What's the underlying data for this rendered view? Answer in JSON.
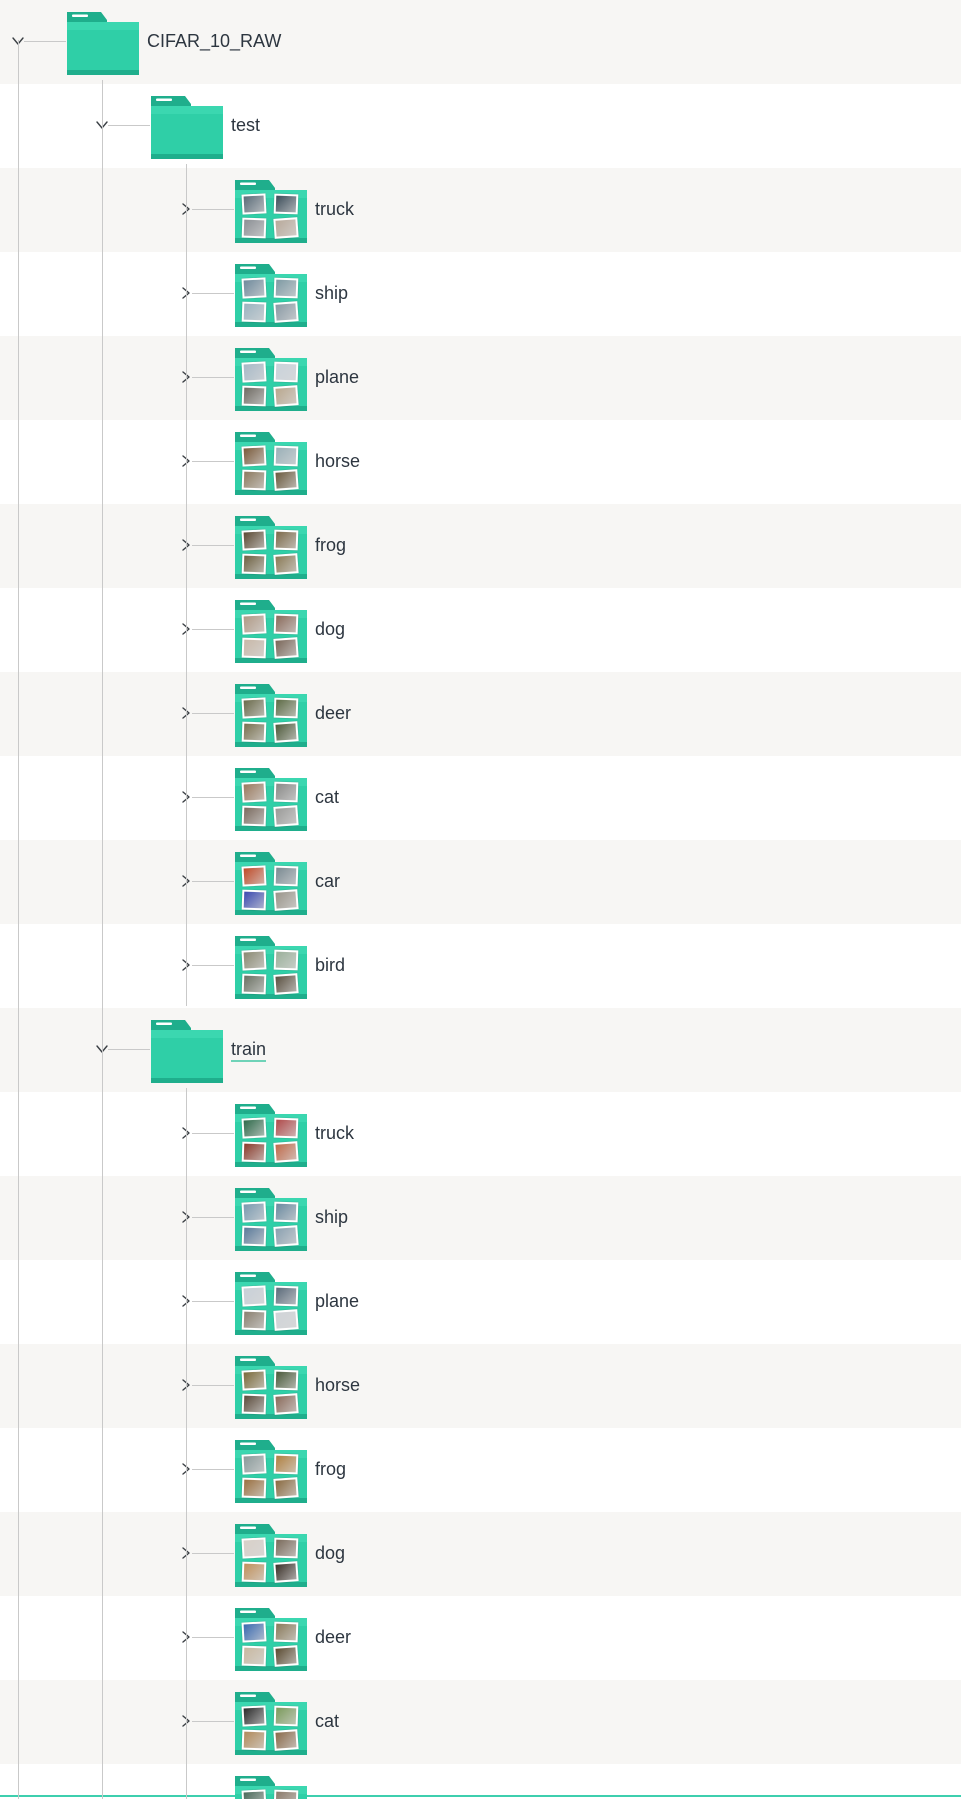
{
  "tree": {
    "root": {
      "label": "CIFAR_10_RAW",
      "expanded": true,
      "children": [
        {
          "label": "test",
          "expanded": true,
          "children": [
            {
              "label": "truck",
              "thumbs": [
                "#5a6b78",
                "#3b4c59",
                "#8b8f94",
                "#b8a99a"
              ]
            },
            {
              "label": "ship",
              "thumbs": [
                "#6f8a9c",
                "#7e9aa4",
                "#9bb3c0",
                "#8a9aa5"
              ]
            },
            {
              "label": "plane",
              "thumbs": [
                "#a7b9c7",
                "#c9d3db",
                "#6e6a62",
                "#b9a78e"
              ]
            },
            {
              "label": "horse",
              "thumbs": [
                "#7a5a3a",
                "#9ab0b8",
                "#8c7a5e",
                "#6b5a3e"
              ]
            },
            {
              "label": "frog",
              "thumbs": [
                "#5b4a33",
                "#7d6a4a",
                "#6d6040",
                "#8a7a55"
              ]
            },
            {
              "label": "dog",
              "thumbs": [
                "#b09a86",
                "#8a6a5a",
                "#c8b8a8",
                "#7a6658"
              ]
            },
            {
              "label": "deer",
              "thumbs": [
                "#6a6a4a",
                "#5d6b45",
                "#78704e",
                "#4e5a3a"
              ]
            },
            {
              "label": "cat",
              "thumbs": [
                "#9a7a5e",
                "#8a8a88",
                "#7a6a5e",
                "#9a9a98"
              ]
            },
            {
              "label": "car",
              "thumbs": [
                "#c04a28",
                "#7a8a92",
                "#3a4ab0",
                "#9a958a"
              ]
            },
            {
              "label": "bird",
              "thumbs": [
                "#8a8a72",
                "#9ab09a",
                "#6a7062",
                "#5a5040"
              ]
            }
          ]
        },
        {
          "label": "train",
          "expanded": true,
          "underlined": true,
          "children": [
            {
              "label": "truck",
              "thumbs": [
                "#2e6a4a",
                "#b04a4a",
                "#8a3a2a",
                "#c06a4a"
              ]
            },
            {
              "label": "ship",
              "thumbs": [
                "#7a9ab0",
                "#6a8aa0",
                "#5a7a9a",
                "#8aa0b0"
              ]
            },
            {
              "label": "plane",
              "thumbs": [
                "#c8d0d8",
                "#5a6a7a",
                "#8a8070",
                "#d0d4d8"
              ]
            },
            {
              "label": "horse",
              "thumbs": [
                "#7a6a3a",
                "#4a5a3a",
                "#5a4a3a",
                "#8a6a5a"
              ]
            },
            {
              "label": "frog",
              "thumbs": [
                "#8a9a9a",
                "#b08040",
                "#9a7040",
                "#8a6a40"
              ]
            },
            {
              "label": "dog",
              "thumbs": [
                "#d8d0c8",
                "#7a6a5a",
                "#c0905a",
                "#3a3028"
              ]
            },
            {
              "label": "deer",
              "thumbs": [
                "#3a6ab0",
                "#8a7a5a",
                "#c8b8a0",
                "#5a4a30"
              ]
            },
            {
              "label": "cat",
              "thumbs": [
                "#2a2a2a",
                "#7a9a5a",
                "#b08a5a",
                "#8a6a4a"
              ]
            },
            {
              "label": "",
              "thumbs": [
                "#4a6a5a",
                "#8a7a6a",
                "#6a5a4a",
                "#7a8a7a"
              ]
            }
          ]
        }
      ]
    }
  },
  "colors": {
    "folder_teal": "#2fcfa7",
    "folder_teal_dark": "#1fae8c",
    "tree_line": "#c9c9c9",
    "row_alt": "#f7f6f4",
    "text": "#2d3640"
  }
}
